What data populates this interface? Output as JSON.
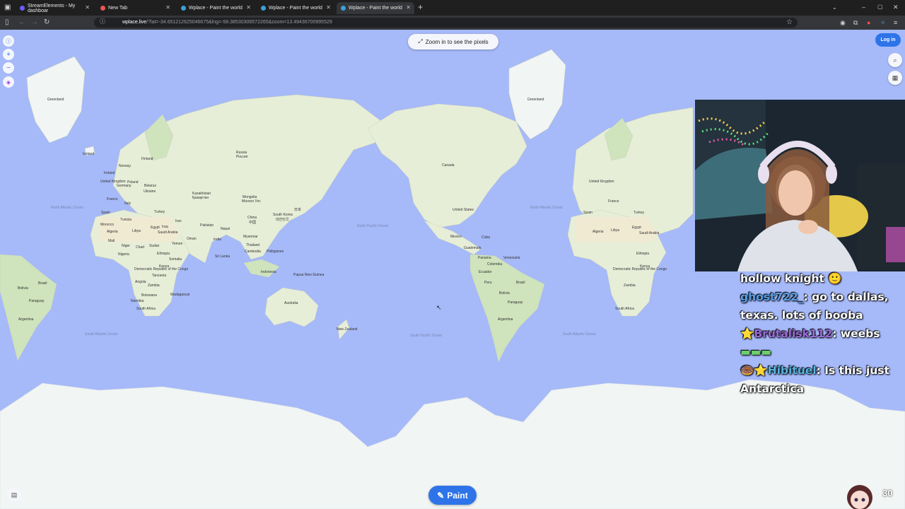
{
  "browser": {
    "tabs": [
      {
        "label": "StreamElements - My dashboar",
        "fav_color": "#6a5cff"
      },
      {
        "label": "New Tab",
        "fav_color": "#e8584f"
      },
      {
        "label": "Wplace - Paint the world",
        "fav_color": "#3aa0d8"
      },
      {
        "label": "Wplace - Paint the world",
        "fav_color": "#3aa0d8"
      },
      {
        "label": "Wplace - Paint the world",
        "fav_color": "#3aa0d8"
      }
    ],
    "new_tab_icon": "+",
    "url_host": "wplace.live",
    "url_rest": "/?lat=-34.651212625046675&lng=-58.38530306572265&zoom=13.49436700995529"
  },
  "map": {
    "zoom_hint": "Zoom in to see the pixels",
    "login_label": "Log in",
    "paint_label": "Paint",
    "labels": {
      "greenland": "Greenland",
      "iceland": "Iceland",
      "norway": "Norway",
      "finland": "Finland",
      "sweden": "Sweden",
      "russia": "Russia",
      "russia_native": "Россия",
      "kazakhstan": "Kazakhstan",
      "kazakhstan_native": "Қазақстан",
      "mongolia": "Mongolia",
      "mongolia_native": "Монгол Улс",
      "china": "China",
      "china_native": "中国",
      "south_korea": "South Korea",
      "south_korea_native": "대한민국",
      "japan": "日本",
      "pakistan": "Pakistan",
      "nepal": "Nepal",
      "india": "India",
      "myanmar": "Myanmar",
      "thailand": "Thailand",
      "cambodia": "Cambodia",
      "philippines": "Philippines",
      "sri_lanka": "Sri Lanka",
      "indonesia": "Indonesia",
      "papua": "Papua New Guinea",
      "australia": "Australia",
      "new_zealand": "New Zealand",
      "canada": "Canada",
      "united_states": "United States",
      "mexico": "Mexico",
      "guatemala": "Guatemala",
      "cuba": "Cuba",
      "panama": "Panama",
      "colombia": "Colombia",
      "venezuela": "Venezuela",
      "ecuador": "Ecuador",
      "peru": "Peru",
      "brazil": "Brasil",
      "bolivia": "Bolivia",
      "paraguay": "Paraguay",
      "argentina": "Argentina",
      "spain": "Spain",
      "france": "France",
      "germany": "Germany",
      "poland": "Poland",
      "ukraine": "Ukraine",
      "italy": "Italy",
      "turkey": "Turkey",
      "united_kingdom": "United Kingdom",
      "ireland": "Ireland",
      "belarus": "Belarus",
      "morocco": "Morocco",
      "algeria": "Algeria",
      "tunisia": "Tunisia",
      "libya": "Libya",
      "egypt": "Egypt",
      "iraq": "Iraq",
      "iran": "Iran",
      "syria": "Syria",
      "saudi_arabia": "Saudi Arabia",
      "yemen": "Yemen",
      "oman": "Oman",
      "mali": "Mali",
      "niger": "Niger",
      "chad": "Chad",
      "sudan": "Sudan",
      "ethiopia": "Ethiopia",
      "somalia": "Somalia",
      "nigeria": "Nigeria",
      "kenya": "Kenya",
      "drc": "Democratic Republic of the Congo",
      "tanzania": "Tanzania",
      "angola": "Angola",
      "zambia": "Zambia",
      "namibia": "Namibia",
      "botswana": "Botswana",
      "south_africa": "South Africa",
      "madagascar": "Madagascar",
      "n_atlantic": "North Atlantic Ocean",
      "s_atlantic": "South Atlantic Ocean",
      "n_pacific": "North Pacific Ocean",
      "s_pacific": "South Pacific Ocean",
      "indian": "Indian Ocean"
    }
  },
  "chat": {
    "line1": "hollow knight 🙂",
    "line2_user": "ghost722_",
    "line2_msg": ": go to dallas,",
    "line3": "texas. lots of booba",
    "line4_badge": "⭐",
    "line4_user": "Brutalisk112",
    "line4_msg": ": weebs",
    "line5_emote": "▬▬▬",
    "line6_badge": "🍩⭐",
    "line6_user": "Hibituel",
    "line6_msg": ": Is this just",
    "line7": "Antarctica"
  },
  "followers": "30",
  "colors": {
    "ocean": "#a6b9f8",
    "land": "#e7eed8",
    "desert": "#f1ead3",
    "forest": "#cfe3bd",
    "ice": "#f1f5f3",
    "accent": "#2e74e8"
  }
}
